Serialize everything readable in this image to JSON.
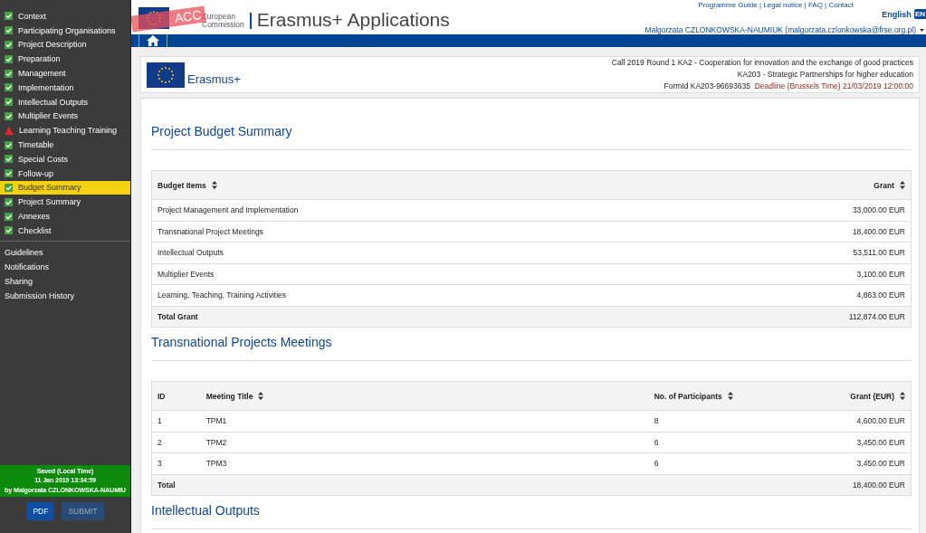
{
  "header": {
    "top_links": "Programme Guide | Legal notice | FAQ | Contact",
    "env_ribbon": "ACC",
    "logo_text": [
      "European",
      "Commission"
    ],
    "app_title": "Erasmus+ Applications",
    "language": "English",
    "language_code": "EN",
    "user": "Malgorzata CZLONKOWSKA-NAUMIUK (malgorzata.czlonkowska@frse.org.pl)"
  },
  "sidebar": {
    "items": [
      {
        "label": "Context",
        "kind": "done",
        "selected": false
      },
      {
        "label": "Participating Organisations",
        "kind": "done",
        "selected": false
      },
      {
        "label": "Project Description",
        "kind": "done",
        "selected": false
      },
      {
        "label": "Preparation",
        "kind": "done",
        "selected": false
      },
      {
        "label": "Management",
        "kind": "done",
        "selected": false
      },
      {
        "label": "Implementation",
        "kind": "done",
        "selected": false
      },
      {
        "label": "Intellectual Outputs",
        "kind": "done",
        "selected": false
      },
      {
        "label": "Multiplier Events",
        "kind": "done",
        "selected": false
      },
      {
        "label": "Learning Teaching Training",
        "kind": "warning",
        "selected": false
      },
      {
        "label": "Timetable",
        "kind": "done",
        "selected": false
      },
      {
        "label": "Special Costs",
        "kind": "done",
        "selected": false
      },
      {
        "label": "Follow-up",
        "kind": "done",
        "selected": false
      },
      {
        "label": "Budget Summary",
        "kind": "done",
        "selected": true
      },
      {
        "label": "Project Summary",
        "kind": "done",
        "selected": false
      },
      {
        "label": "Annexes",
        "kind": "done",
        "selected": false
      },
      {
        "label": "Checklist",
        "kind": "done",
        "selected": false
      }
    ],
    "links": [
      "Guidelines",
      "Notifications",
      "Sharing",
      "Submission History"
    ],
    "save_status": [
      "Saved (Local Time)",
      "11 Jan 2019 13:34:59",
      "by Malgorzata CZLONKOWSKA-NAUMIU"
    ],
    "buttons": [
      {
        "label": "PDF",
        "disabled": false
      },
      {
        "label": "SUBMIT",
        "disabled": true
      }
    ]
  },
  "form_header": {
    "brand": "Erasmus+",
    "call": "Call 2019  Round 1  KA2 - Cooperation for innovation and the exchange of good practices",
    "action": "KA203 - Strategic Partnerships for higher education",
    "form_id": "FormId KA203-96693635",
    "deadline": "Deadline (Brussels Time) 21/03/2019 12:00:00"
  },
  "sections": [
    {
      "title": "Project Budget Summary",
      "table": {
        "columns": [
          {
            "label": "Budget Items",
            "sortable": true
          },
          {
            "label": "Grant",
            "sortable": true
          }
        ],
        "rows": [
          {
            "kind": "item",
            "cells": [
              "Project Management and Implementation",
              "33,000.00 EUR"
            ]
          },
          {
            "kind": "item",
            "cells": [
              "Transnational Project Meetings",
              "18,400.00 EUR"
            ]
          },
          {
            "kind": "item",
            "cells": [
              "Intellectual Outputs",
              "53,511.00 EUR"
            ]
          },
          {
            "kind": "item",
            "cells": [
              "Multiplier Events",
              "3,100.00 EUR"
            ]
          },
          {
            "kind": "item",
            "cells": [
              "Learning, Teaching, Training Activities",
              "4,863.00 EUR"
            ]
          },
          {
            "kind": "total",
            "cells": [
              "Total Grant",
              "112,874.00 EUR"
            ]
          }
        ]
      }
    },
    {
      "title": "Transnational Projects Meetings",
      "table": {
        "columns": [
          {
            "label": "ID",
            "sortable": false
          },
          {
            "label": "Meeting Title",
            "sortable": true
          },
          {
            "label": "No. of Participants",
            "sortable": true
          },
          {
            "label": "Grant (EUR)",
            "sortable": true
          }
        ],
        "rows": [
          {
            "kind": "item",
            "cells": [
              "1",
              "TPM1",
              "8",
              "4,600.00 EUR"
            ]
          },
          {
            "kind": "item",
            "cells": [
              "2",
              "TPM2",
              "6",
              "3,450.00 EUR"
            ]
          },
          {
            "kind": "item",
            "cells": [
              "3",
              "TPM3",
              "6",
              "3,450.00 EUR"
            ]
          },
          {
            "kind": "total",
            "cells": [
              "Total",
              "",
              "",
              "18,400.00 EUR"
            ]
          }
        ]
      }
    },
    {
      "title": "Intellectual Outputs"
    }
  ]
}
